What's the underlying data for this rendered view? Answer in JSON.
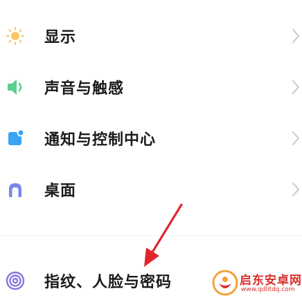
{
  "settings": {
    "items": [
      {
        "label": "显示",
        "icon": "sun-icon"
      },
      {
        "label": "声音与触感",
        "icon": "speaker-icon"
      },
      {
        "label": "通知与控制中心",
        "icon": "notification-icon"
      },
      {
        "label": "桌面",
        "icon": "home-icon"
      },
      {
        "label": "指纹、人脸与密码",
        "icon": "fingerprint-icon"
      }
    ]
  },
  "watermark": {
    "title": "启东安卓网",
    "url": "www.qdlitdq.com"
  },
  "colors": {
    "sun": "#f5c96a",
    "speaker": "#5ccf92",
    "notification": "#3aa4f4",
    "home": "#7b86e8",
    "fingerprint": "#8177dd",
    "chevron": "#c8c8c8",
    "arrow": "#e0262b",
    "watermark": "#d7302a"
  }
}
